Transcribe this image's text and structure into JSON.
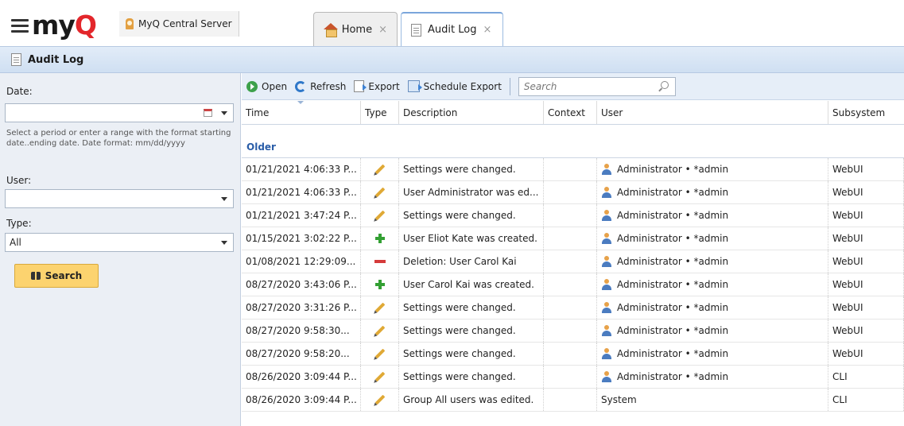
{
  "app": {
    "logo_text_a": "my",
    "logo_text_b": "Q",
    "server_name": "MyQ Central Server"
  },
  "tabs": [
    {
      "label": "Home",
      "icon": "home-icon",
      "close": "×"
    },
    {
      "label": "Audit Log",
      "icon": "document-icon",
      "close": "×"
    }
  ],
  "page": {
    "title": "Audit Log"
  },
  "filters": {
    "date_label": "Date:",
    "date_value": "",
    "date_hint": "Select a period or enter a range with the format starting date..ending date. Date format: mm/dd/yyyy",
    "user_label": "User:",
    "user_value": "",
    "type_label": "Type:",
    "type_value": "All",
    "search_label": "Search"
  },
  "toolbar": {
    "open": "Open",
    "refresh": "Refresh",
    "export": "Export",
    "schedule_export": "Schedule Export",
    "search_placeholder": "Search"
  },
  "grid": {
    "columns": [
      "Time",
      "Type",
      "Description",
      "Context",
      "User",
      "Subsystem"
    ],
    "group_label": "Older",
    "rows": [
      {
        "time": "01/21/2021 4:06:33 P...",
        "type": "edit",
        "description": "Settings were changed.",
        "context": "",
        "user": "Administrator • *admin",
        "user_icon": true,
        "subsystem": "WebUI"
      },
      {
        "time": "01/21/2021 4:06:33 P...",
        "type": "edit",
        "description": "User Administrator was ed...",
        "context": "",
        "user": "Administrator • *admin",
        "user_icon": true,
        "subsystem": "WebUI"
      },
      {
        "time": "01/21/2021 3:47:24 P...",
        "type": "edit",
        "description": "Settings were changed.",
        "context": "",
        "user": "Administrator • *admin",
        "user_icon": true,
        "subsystem": "WebUI"
      },
      {
        "time": "01/15/2021 3:02:22 P...",
        "type": "create",
        "description": "User Eliot Kate was created.",
        "context": "",
        "user": "Administrator • *admin",
        "user_icon": true,
        "subsystem": "WebUI"
      },
      {
        "time": "01/08/2021 12:29:09...",
        "type": "delete",
        "description": "Deletion: User Carol Kai",
        "context": "",
        "user": "Administrator • *admin",
        "user_icon": true,
        "subsystem": "WebUI"
      },
      {
        "time": "08/27/2020 3:43:06 P...",
        "type": "create",
        "description": "User Carol Kai was created.",
        "context": "",
        "user": "Administrator • *admin",
        "user_icon": true,
        "subsystem": "WebUI"
      },
      {
        "time": "08/27/2020 3:31:26 P...",
        "type": "edit",
        "description": "Settings were changed.",
        "context": "",
        "user": "Administrator • *admin",
        "user_icon": true,
        "subsystem": "WebUI"
      },
      {
        "time": "08/27/2020 9:58:30...",
        "type": "edit",
        "description": "Settings were changed.",
        "context": "",
        "user": "Administrator • *admin",
        "user_icon": true,
        "subsystem": "WebUI"
      },
      {
        "time": "08/27/2020 9:58:20...",
        "type": "edit",
        "description": "Settings were changed.",
        "context": "",
        "user": "Administrator • *admin",
        "user_icon": true,
        "subsystem": "WebUI"
      },
      {
        "time": "08/26/2020 3:09:44 P...",
        "type": "edit",
        "description": "Settings were changed.",
        "context": "",
        "user": "Administrator • *admin",
        "user_icon": true,
        "subsystem": "CLI"
      },
      {
        "time": "08/26/2020 3:09:44 P...",
        "type": "edit",
        "description": "Group All users was edited.",
        "context": "",
        "user": "System",
        "user_icon": false,
        "subsystem": "CLI"
      }
    ]
  }
}
